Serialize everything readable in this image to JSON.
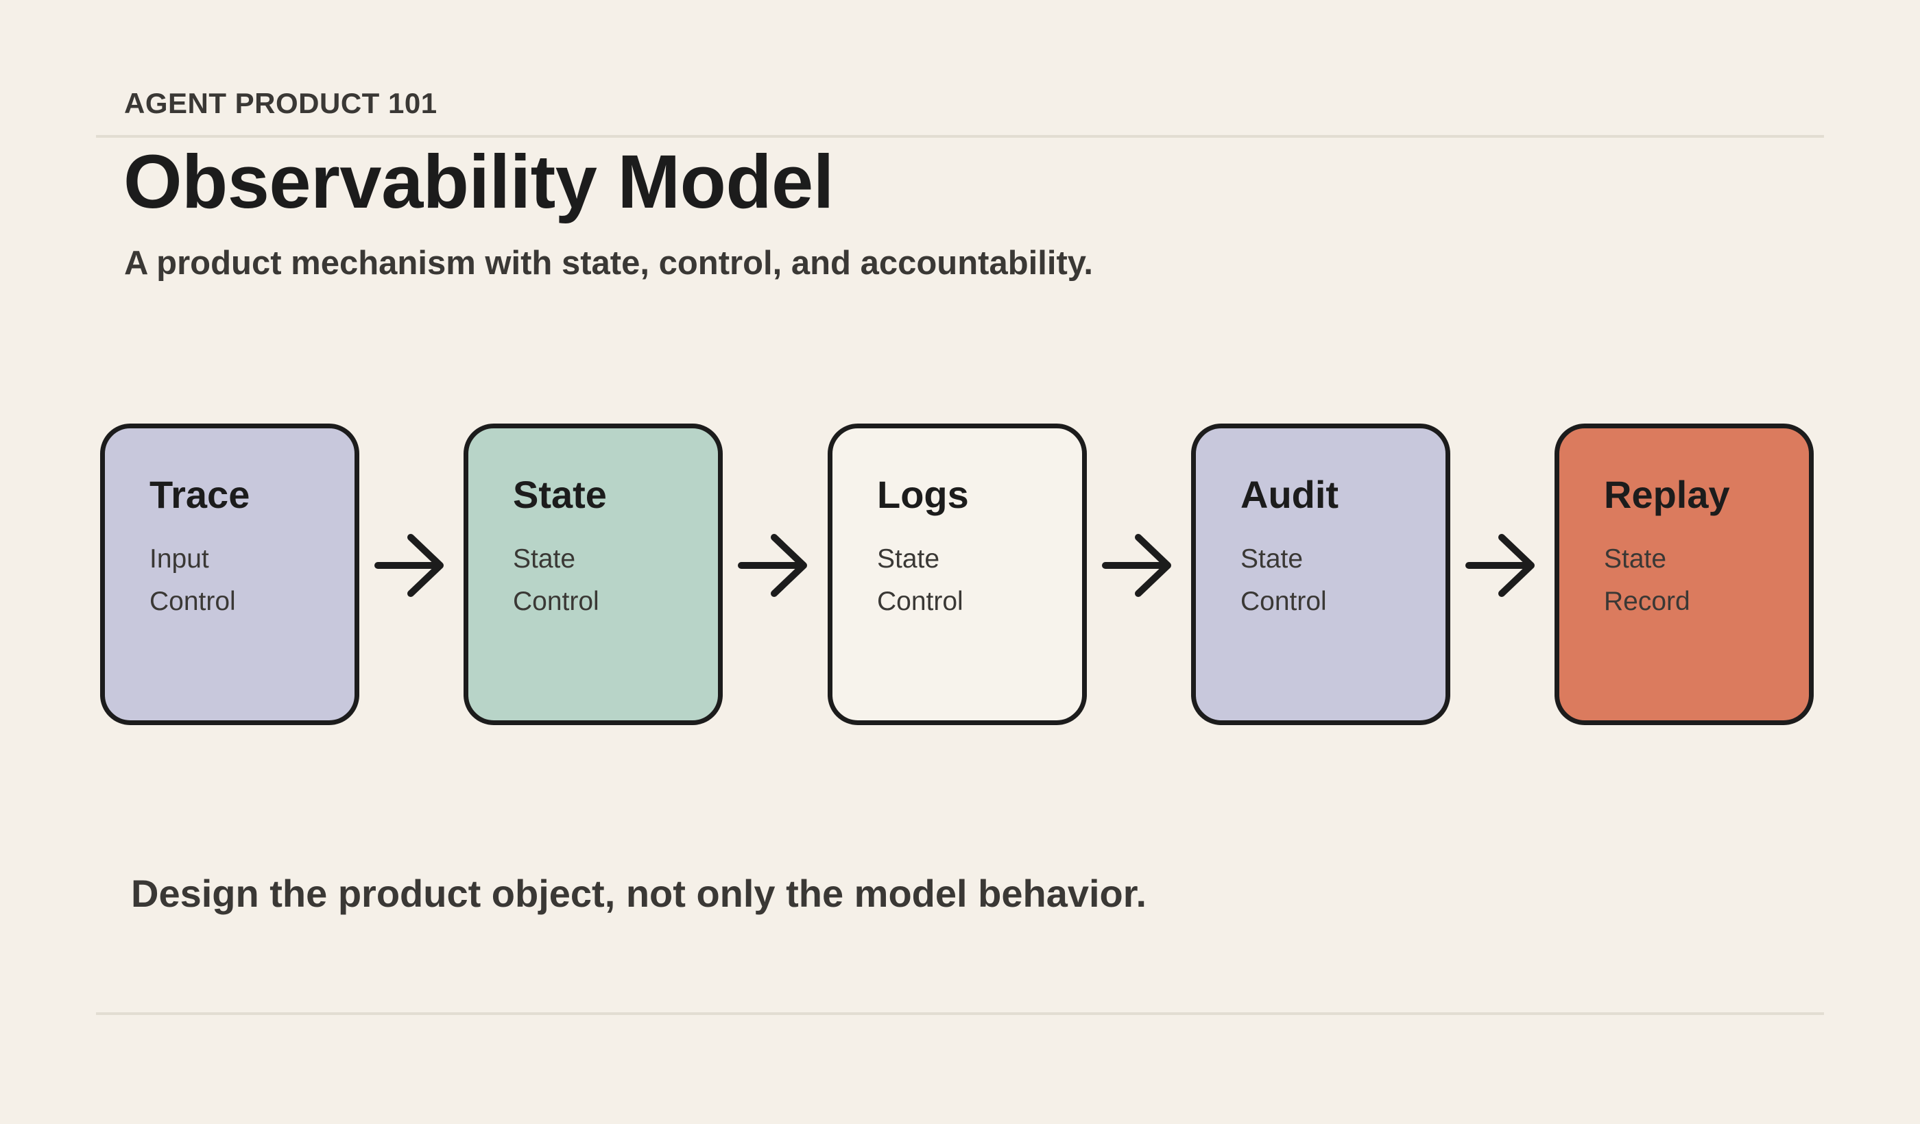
{
  "header": {
    "eyebrow": "AGENT PRODUCT 101",
    "title": "Observability Model",
    "subtitle": "A product mechanism with state, control, and accountability."
  },
  "flow": {
    "steps": [
      {
        "title": "Trace",
        "lines": [
          "Input",
          "Control"
        ],
        "color": "#c8c8dc"
      },
      {
        "title": "State",
        "lines": [
          "State",
          "Control"
        ],
        "color": "#b8d4c8"
      },
      {
        "title": "Logs",
        "lines": [
          "State",
          "Control"
        ],
        "color": "#f7f3ec"
      },
      {
        "title": "Audit",
        "lines": [
          "State",
          "Control"
        ],
        "color": "#c8c8dc"
      },
      {
        "title": "Replay",
        "lines": [
          "State",
          "Record"
        ],
        "color": "#db7b5e"
      }
    ],
    "connector_icon": "arrow-right-icon",
    "stroke_color": "#1c1c1c"
  },
  "footer": {
    "note": "Design the product object, not only the model behavior."
  }
}
